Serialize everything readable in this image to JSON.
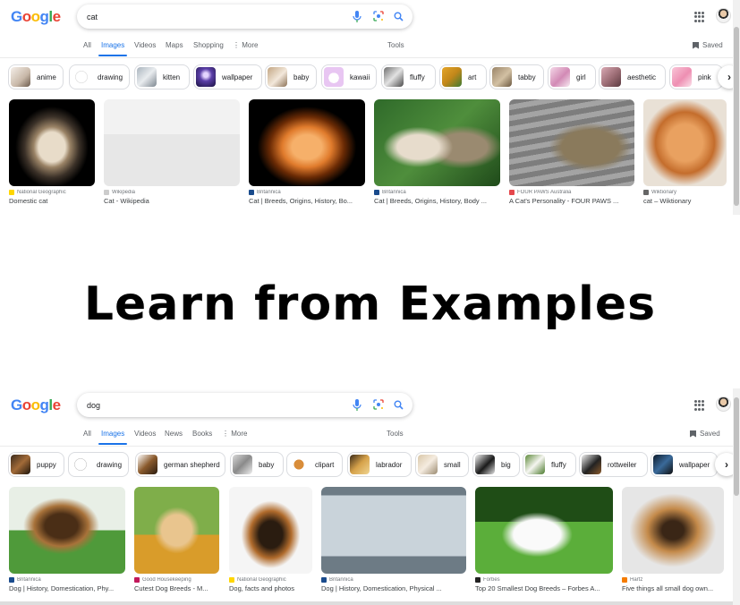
{
  "colors": {
    "accent": "#1a73e8",
    "text_secondary": "#5f6368",
    "source_text": "#70757a"
  },
  "logo_text": "Google",
  "banner": {
    "text": "Learn from Examples"
  },
  "panels": [
    {
      "query": "cat",
      "tabs": [
        {
          "label": "All",
          "active": false
        },
        {
          "label": "Images",
          "active": true
        },
        {
          "label": "Videos",
          "active": false
        },
        {
          "label": "Maps",
          "active": false
        },
        {
          "label": "Shopping",
          "active": false
        },
        {
          "label": "⋮ More",
          "active": false
        }
      ],
      "tools_label": "Tools",
      "saved_label": "Saved",
      "chips": [
        "anime",
        "drawing",
        "kitten",
        "wallpaper",
        "baby",
        "kawaii",
        "fluffy",
        "art",
        "tabby",
        "girl",
        "aesthetic",
        "pink"
      ],
      "results": [
        {
          "source": "National Geographic",
          "title": "Domestic cat"
        },
        {
          "source": "Wikipedia",
          "title": "Cat - Wikipedia"
        },
        {
          "source": "Britannica",
          "title": "Cat | Breeds, Origins, History, Bo..."
        },
        {
          "source": "Britannica",
          "title": "Cat | Breeds, Origins, History, Body ..."
        },
        {
          "source": "FOUR PAWS Australia",
          "title": "A Cat's Personality - FOUR PAWS ..."
        },
        {
          "source": "Wiktionary",
          "title": "cat – Wiktionary"
        }
      ]
    },
    {
      "query": "dog",
      "tabs": [
        {
          "label": "All",
          "active": false
        },
        {
          "label": "Images",
          "active": true
        },
        {
          "label": "Videos",
          "active": false
        },
        {
          "label": "News",
          "active": false
        },
        {
          "label": "Books",
          "active": false
        },
        {
          "label": "⋮ More",
          "active": false
        }
      ],
      "tools_label": "Tools",
      "saved_label": "Saved",
      "chips": [
        "puppy",
        "drawing",
        "german shepherd",
        "baby",
        "clipart",
        "labrador",
        "small",
        "big",
        "fluffy",
        "rottweiler",
        "wallpaper"
      ],
      "results": [
        {
          "source": "Britannica",
          "title": "Dog | History, Domestication, Phy..."
        },
        {
          "source": "Good Housekeeping",
          "title": "Cutest Dog Breeds - M..."
        },
        {
          "source": "National Geographic",
          "title": "Dog, facts and photos"
        },
        {
          "source": "Britannica",
          "title": "Dog | History, Domestication, Physical ..."
        },
        {
          "source": "Forbes",
          "title": "Top 20 Smallest Dog Breeds – Forbes A..."
        },
        {
          "source": "Hartz",
          "title": "Five things all small dog own..."
        }
      ]
    }
  ]
}
